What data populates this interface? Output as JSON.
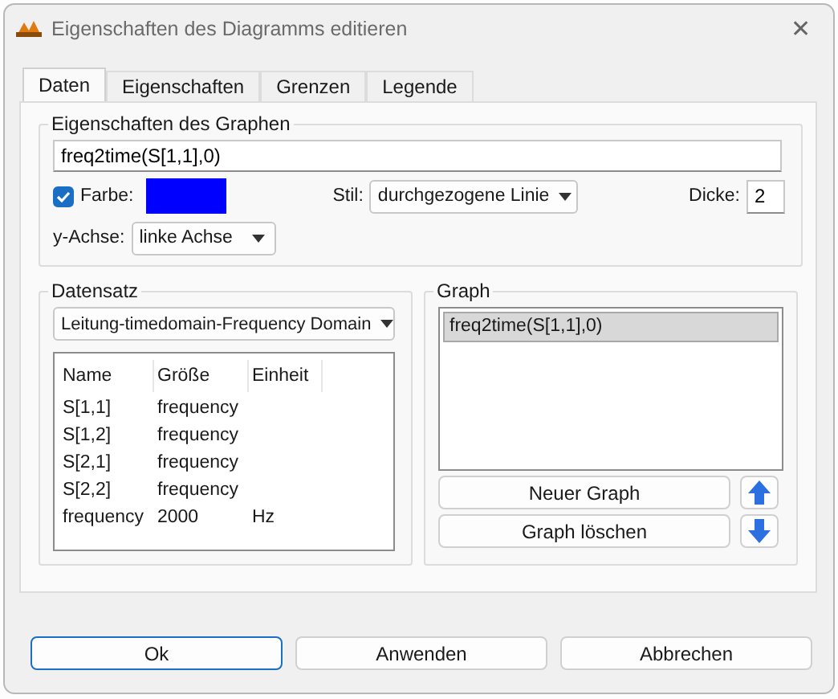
{
  "window": {
    "title": "Eigenschaften des Diagramms editieren",
    "close": "✕"
  },
  "tabs": [
    {
      "label": "Daten",
      "selected": true
    },
    {
      "label": "Eigenschaften",
      "selected": false
    },
    {
      "label": "Grenzen",
      "selected": false
    },
    {
      "label": "Legende",
      "selected": false
    }
  ],
  "graph_properties": {
    "legend": "Eigenschaften des Graphen",
    "expression": "freq2time(S[1,1],0)",
    "color_checkbox": {
      "label": "Farbe:",
      "checked": true
    },
    "color": "#0000ff",
    "style_label": "Stil:",
    "style_value": "durchgezogene Linie",
    "thickness_label": "Dicke:",
    "thickness_value": "2",
    "y_axis_label": "y-Achse:",
    "y_axis_value": "linke Achse"
  },
  "dataset": {
    "legend": "Datensatz",
    "source": "Leitung-timedomain-Frequency Domain",
    "columns": [
      "Name",
      "Größe",
      "Einheit"
    ],
    "rows": [
      [
        "S[1,1]",
        "frequency",
        ""
      ],
      [
        "S[1,2]",
        "frequency",
        ""
      ],
      [
        "S[2,1]",
        "frequency",
        ""
      ],
      [
        "S[2,2]",
        "frequency",
        ""
      ],
      [
        "frequency",
        "2000",
        "Hz"
      ]
    ]
  },
  "graph": {
    "legend": "Graph",
    "items": [
      {
        "label": "freq2time(S[1,1],0)",
        "selected": true
      }
    ],
    "new_button": "Neuer Graph",
    "delete_button": "Graph löschen"
  },
  "buttons": [
    {
      "label": "Ok",
      "default": true
    },
    {
      "label": "Anwenden",
      "default": false
    },
    {
      "label": "Abbrechen",
      "default": false
    }
  ]
}
